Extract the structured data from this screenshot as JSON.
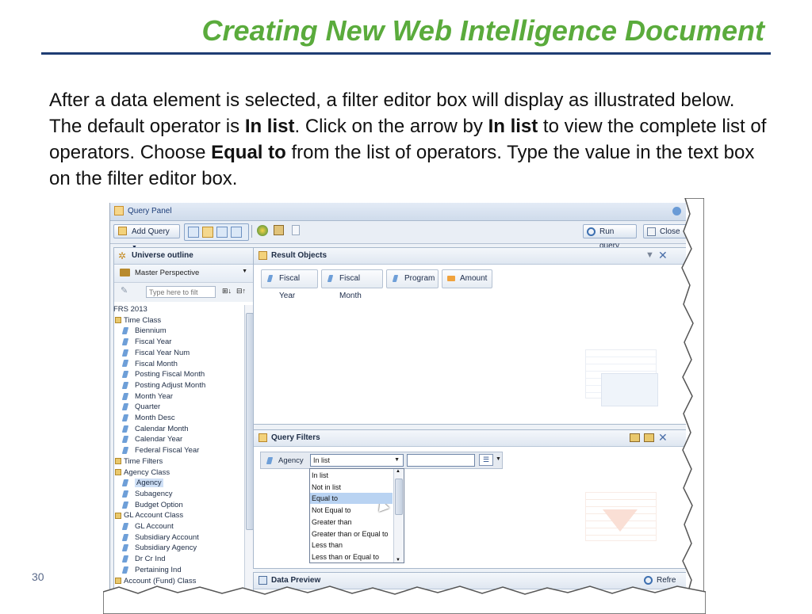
{
  "slide": {
    "title": "Creating New Web Intelligence Document",
    "para_1": "After a data element is selected, a filter editor box will display as illustrated below. The default operator is ",
    "bold_1": "In list",
    "para_2": ". Click on the arrow by ",
    "bold_2": "In list",
    "para_3": " to view the complete list of operators. Choose ",
    "bold_3": "Equal to",
    "para_4": " from the list of operators.  Type the value in the text box on the filter editor box.",
    "page_number": "30"
  },
  "query_panel": {
    "title": "Query Panel",
    "add_query": "Add Query",
    "run_query": "Run query",
    "close": "Close"
  },
  "universe": {
    "header": "Universe outline",
    "perspective": "Master Perspective",
    "search_placeholder": "Type here to filt",
    "tree": [
      "FRS 2013",
      "Time Class",
      "Biennium",
      "Fiscal Year",
      "Fiscal Year Num",
      "Fiscal Month",
      "Posting Fiscal Month",
      "Posting Adjust Month",
      "Month Year",
      "Quarter",
      "Month Desc",
      "Calendar Month",
      "Calendar Year",
      "Federal Fiscal Year",
      "Time Filters",
      "Agency Class",
      "Agency",
      "Subagency",
      "Budget Option",
      "GL Account Class",
      "GL Account",
      "Subsidiary Account",
      "Subsidiary Agency",
      "Dr Cr Ind",
      "Pertaining Ind",
      "Account (Fund) Class"
    ]
  },
  "result_objects": {
    "header": "Result Objects",
    "items": [
      "Fiscal Year",
      "Fiscal Month",
      "Program",
      "Amount"
    ]
  },
  "query_filters": {
    "header": "Query Filters",
    "field": "Agency",
    "operator": "In list",
    "value": "",
    "operators": [
      "In list",
      "Not in list",
      "Equal to",
      "Not Equal to",
      "Greater than",
      "Greater than or Equal to",
      "Less than",
      "Less than or Equal to"
    ],
    "selected_operator": "Equal to"
  },
  "data_preview": {
    "header": "Data Preview",
    "refresh": "Refre"
  },
  "colors": {
    "title_green": "#5aab3c",
    "rule_navy": "#1f3d73",
    "selection_blue": "#b9d3f2"
  }
}
